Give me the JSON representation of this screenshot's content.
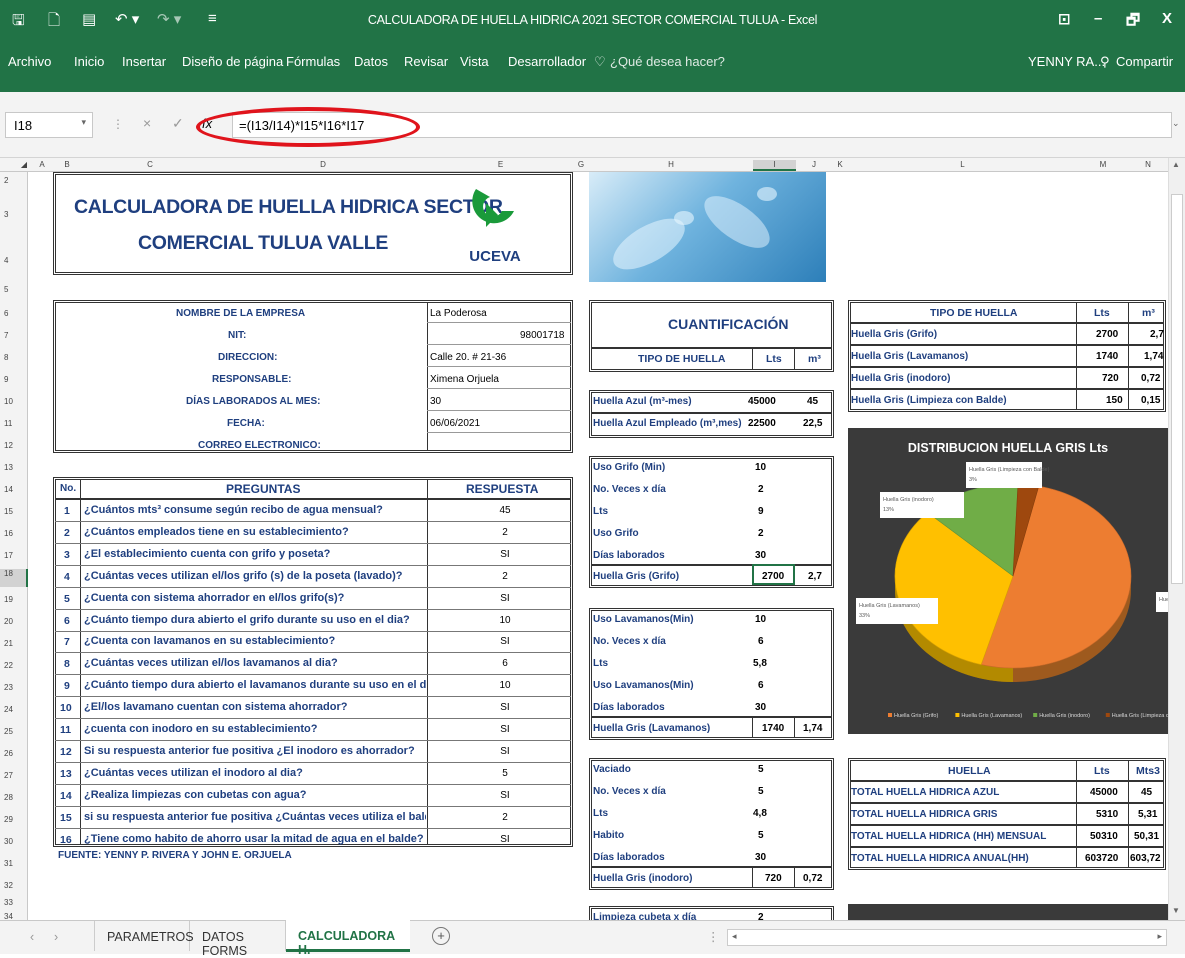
{
  "window": {
    "title": "CALCULADORA DE HUELLA HIDRICA 2021 SECTOR COMERCIAL TULUA - Excel",
    "min": "–",
    "restore": "🗗",
    "close": "X"
  },
  "ribbon": {
    "tabs": [
      "Archivo",
      "Inicio",
      "Insertar",
      "Diseño de página",
      "Fórmulas",
      "Datos",
      "Revisar",
      "Vista",
      "Desarrollador"
    ],
    "search": "¿Qué desea hacer?",
    "user": "YENNY RA...",
    "share": "Compartir"
  },
  "formula": {
    "cell_ref": "I18",
    "content": "=(I13/I14)*I15*I16*I17",
    "cancel": "×",
    "enter": "✓",
    "fx": "fx"
  },
  "columns": [
    "A",
    "B",
    "C",
    "D",
    "E",
    "G",
    "H",
    "I",
    "J",
    "K",
    "L",
    "M",
    "N"
  ],
  "rows": [
    "2",
    "3",
    "4",
    "5",
    "6",
    "7",
    "8",
    "9",
    "10",
    "11",
    "12",
    "13",
    "14",
    "15",
    "16",
    "17",
    "18",
    "19",
    "20",
    "21",
    "22",
    "23",
    "24",
    "25",
    "26",
    "27",
    "28",
    "29",
    "30",
    "31",
    "32",
    "33",
    "34"
  ],
  "header": {
    "title_line1": "CALCULADORA DE HUELLA HIDRICA SECTOR",
    "title_line2": "COMERCIAL TULUA VALLE",
    "logo": "UCEVA"
  },
  "company": {
    "labels": [
      "NOMBRE DE LA EMPRESA",
      "NIT:",
      "DIRECCION:",
      "RESPONSABLE:",
      "DÍAS LABORADOS AL MES:",
      "FECHA:",
      "CORREO ELECTRONICO:"
    ],
    "values": [
      "La Poderosa",
      "98001718",
      "Calle 20. # 21-36",
      "Ximena Orjuela",
      "30",
      "06/06/2021",
      ""
    ]
  },
  "questions": {
    "col_no": "No.",
    "col_q": "PREGUNTAS",
    "col_r": "RESPUESTA",
    "nums": [
      "1",
      "2",
      "3",
      "4",
      "5",
      "6",
      "7",
      "8",
      "9",
      "10",
      "11",
      "12",
      "13",
      "14",
      "15",
      "16"
    ],
    "items": [
      "¿Cuántos mts³ consume según recibo de agua mensual?",
      "¿Cuántos empleados tiene en su establecimiento?",
      "¿El establecimiento cuenta con grifo y poseta?",
      "¿Cuántas veces utilizan el/los grifo (s) de la poseta (lavado)?",
      "¿Cuenta con sistema ahorrador en el/los grifo(s)?",
      "¿Cuánto tiempo dura abierto el grifo durante su uso en el dia?",
      "¿Cuenta con lavamanos en su establecimiento?",
      "¿Cuántas veces utilizan el/los lavamanos al dia?",
      "¿Cuánto tiempo dura abierto el lavamanos durante su uso en el día?",
      "¿El/los lavamano cuentan con sistema ahorrador?",
      "¿cuenta con inodoro en su establecimiento?",
      "Si su respuesta anterior fue positiva ¿El inodoro es ahorrador?",
      "¿Cuántas veces utilizan el inodoro al dia?",
      "¿Realiza limpiezas con cubetas con agua?",
      "si su respuesta anterior fue positiva ¿Cuántas veces utiliza el balde en la",
      "¿Tiene como habito de ahorro usar la mitad de agua en el balde?"
    ],
    "answers": [
      "45",
      "2",
      "SI",
      "2",
      "SI",
      "10",
      "SI",
      "6",
      "10",
      "SI",
      "SI",
      "SI",
      "5",
      "SI",
      "2",
      "SI"
    ],
    "source": "FUENTE: YENNY P. RIVERA Y JOHN E. ORJUELA"
  },
  "quant": {
    "title": "CUANTIFICACIÓN",
    "col_tipo": "TIPO DE HUELLA",
    "col_lts": "Lts",
    "col_m3": "m³",
    "azul": [
      {
        "label": "Huella Azul (m³-mes)",
        "lts": "45000",
        "m3": "45"
      },
      {
        "label": "Huella Azul Empleado (m³,mes)",
        "lts": "22500",
        "m3": "22,5"
      }
    ],
    "grifo": {
      "rows": [
        [
          "Uso Grifo (Min)",
          "10"
        ],
        [
          "No. Veces x día",
          "2"
        ],
        [
          "Lts",
          "9"
        ],
        [
          "Uso Grifo",
          "2"
        ],
        [
          "Días laborados",
          "30"
        ]
      ],
      "total_label": "Huella Gris (Grifo)",
      "lts": "2700",
      "m3": "2,7"
    },
    "lav": {
      "rows": [
        [
          "Uso Lavamanos(Min)",
          "10"
        ],
        [
          "No. Veces x día",
          "6"
        ],
        [
          "Lts",
          "5,8"
        ],
        [
          "Uso Lavamanos(Min)",
          "6"
        ],
        [
          "Días laborados",
          "30"
        ]
      ],
      "total_label": "Huella Gris (Lavamanos)",
      "lts": "1740",
      "m3": "1,74"
    },
    "ino": {
      "rows": [
        [
          "Vaciado",
          "5"
        ],
        [
          "No. Veces x día",
          "5"
        ],
        [
          "Lts",
          "4,8"
        ],
        [
          "Habito",
          "5"
        ],
        [
          "Días laborados",
          "30"
        ]
      ],
      "total_label": "Huella Gris (inodoro)",
      "lts": "720",
      "m3": "0,72"
    },
    "balde_first": [
      "Limpieza cubeta x día",
      "2"
    ]
  },
  "tipo": {
    "title": "TIPO DE HUELLA",
    "col_lts": "Lts",
    "col_m3": "m³",
    "rows": [
      [
        "Huella Gris (Grifo)",
        "2700",
        "2,7"
      ],
      [
        "Huella Gris (Lavamanos)",
        "1740",
        "1,74"
      ],
      [
        "Huella Gris (inodoro)",
        "720",
        "0,72"
      ],
      [
        "Huella Gris (Limpieza con Balde)",
        "150",
        "0,15"
      ]
    ]
  },
  "chart_data": {
    "type": "pie",
    "title": "DISTRIBUCION HUELLA GRIS Lts",
    "categories": [
      "Huella Gris (Grifo)",
      "Huella Gris (Lavamanos)",
      "Huella Gris (inodoro)",
      "Huella Gris (Limpieza con Balde)"
    ],
    "values": [
      2700,
      1740,
      720,
      150
    ],
    "labels": [
      "Hue",
      "Huella Gris (Lavamanos) 33%",
      "Huella Gris (inodoro) 13%",
      "Huella Gris (Limpieza con Balde) 3%"
    ],
    "colors": [
      "#ed7d31",
      "#ffc000",
      "#70ad47",
      "#9e480e"
    ],
    "legend": "bottom"
  },
  "totals": {
    "title": "HUELLA",
    "col_lts": "Lts",
    "col_m3": "Mts3",
    "rows": [
      [
        "TOTAL HUELLA HIDRICA AZUL",
        "45000",
        "45"
      ],
      [
        "TOTAL HUELLA HIDRICA GRIS",
        "5310",
        "5,31"
      ],
      [
        "TOTAL HUELLA HIDRICA (HH) MENSUAL",
        "50310",
        "50,31"
      ],
      [
        "TOTAL HUELLA HIDRICA ANUAL(HH)",
        "603720",
        "603,72"
      ]
    ]
  },
  "sheets": [
    "PARAMETROS",
    "DATOS FORMS",
    "CALCULADORA H."
  ]
}
